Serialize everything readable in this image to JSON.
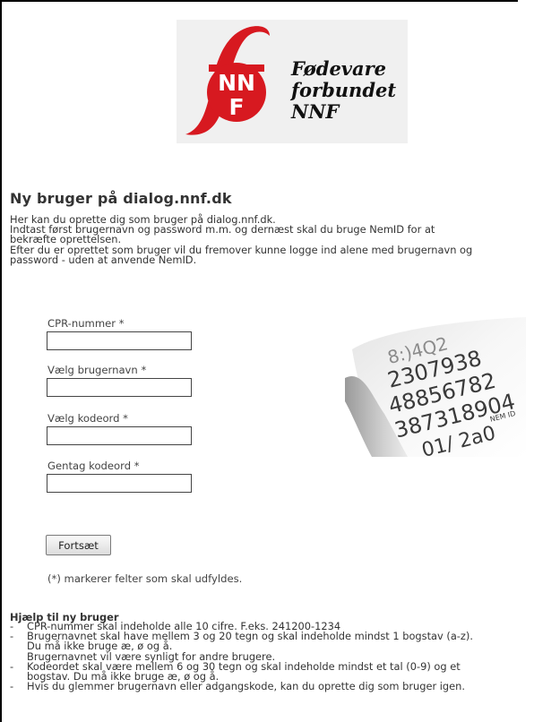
{
  "logo": {
    "letters": "f",
    "mark_top": "NN",
    "mark_bottom": "F",
    "name_line1": "Fødevare",
    "name_line2": "forbundet",
    "name_line3": "NNF",
    "brand_red": "#d71920",
    "background": "#f0f0f0"
  },
  "page": {
    "title": "Ny bruger på dialog.nnf.dk",
    "intro_lines": [
      "Her kan du oprette dig som bruger på dialog.nnf.dk.",
      "Indtast først brugernavn og password m.m. og dernæst skal du bruge NemID for at",
      "bekræfte oprettelsen.",
      "Efter du er oprettet som bruger vil du fremover kunne logge ind alene med brugernavn og",
      "password - uden at anvende NemID."
    ]
  },
  "form": {
    "fields": [
      {
        "label": "CPR-nummer *",
        "value": ""
      },
      {
        "label": "Vælg brugernavn *",
        "value": ""
      },
      {
        "label": "Vælg kodeord *",
        "value": ""
      },
      {
        "label": "Gentag kodeord *",
        "value": ""
      }
    ],
    "submit_label": "Fortsæt",
    "required_note": "(*) markerer felter som skal udfyldes."
  },
  "nemid_card": {
    "icon": "nemid-code-card-image",
    "brand_text": "NEM ID"
  },
  "help": {
    "title": "Hjælp til ny bruger",
    "items": [
      {
        "lines": [
          "CPR-nummer skal indeholde alle 10 cifre. F.eks. 241200-1234"
        ]
      },
      {
        "lines": [
          "Brugernavnet skal have mellem 3 og 20 tegn og skal indeholde mindst 1 bogstav (a-z).",
          "Du må ikke bruge æ, ø og å.",
          "Brugernavnet vil være synligt for andre brugere."
        ]
      },
      {
        "lines": [
          "Kodeordet skal være mellem 6 og 30 tegn og skal indeholde mindst et tal (0-9) og et",
          "bogstav. Du må ikke bruge æ, ø og å."
        ]
      },
      {
        "lines": [
          "Hvis du glemmer brugernavn eller adgangskode, kan du oprette dig som bruger igen."
        ]
      }
    ]
  }
}
